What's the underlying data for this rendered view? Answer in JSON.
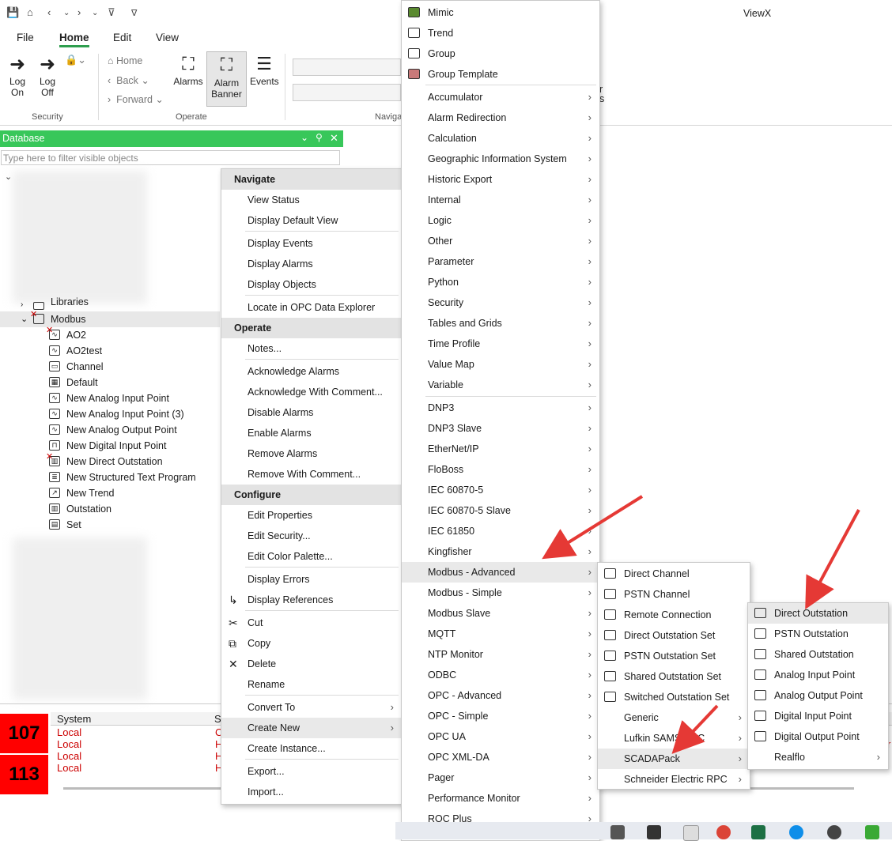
{
  "app": {
    "title": "ViewX"
  },
  "quick_access": {
    "icons": [
      "save-icon",
      "home-icon",
      "back-icon",
      "chevron-down-icon",
      "forward-icon",
      "chevron-down-icon",
      "pointer-icon",
      "customize-icon"
    ]
  },
  "menu_tabs": [
    "File",
    "Home",
    "Edit",
    "View"
  ],
  "ribbon": {
    "log_on": "Log\nOn",
    "log_off": "Log\nOff",
    "home": "Home",
    "back": "Back",
    "forward": "Forward",
    "alarms": "Alarms",
    "alarm_banner": "Alarm\nBanner",
    "events": "Events",
    "groups": {
      "security": "Security",
      "operate": "Operate",
      "navigate": "Naviga"
    },
    "right_partial": [
      "r",
      "s"
    ]
  },
  "database": {
    "title": "Database",
    "filter_placeholder": "Type here to filter visible objects",
    "tree": [
      {
        "label": "Libraries",
        "icon": "folder-icon"
      },
      {
        "label": "Modbus",
        "icon": "folder-icon"
      },
      {
        "label": "AO2",
        "icon": "analog-output-icon"
      },
      {
        "label": "AO2test",
        "icon": "analog-output-icon"
      },
      {
        "label": "Channel",
        "icon": "channel-icon"
      },
      {
        "label": "Default",
        "icon": "mimic-icon"
      },
      {
        "label": "New Analog Input Point",
        "icon": "analog-input-icon"
      },
      {
        "label": "New Analog Input Point (3)",
        "icon": "analog-input-icon"
      },
      {
        "label": "New Analog Output Point",
        "icon": "analog-output-icon"
      },
      {
        "label": "New Digital Input Point",
        "icon": "digital-input-icon"
      },
      {
        "label": "New Direct Outstation",
        "icon": "outstation-icon"
      },
      {
        "label": "New Structured Text Program",
        "icon": "program-icon"
      },
      {
        "label": "New Trend",
        "icon": "trend-icon"
      },
      {
        "label": "Outstation",
        "icon": "outstation-icon"
      },
      {
        "label": "Set",
        "icon": "set-icon"
      }
    ]
  },
  "alarm_banner": {
    "counts": [
      "107",
      "113"
    ],
    "column": "System",
    "column2": "S",
    "rows": [
      "Local",
      "Local",
      "Local",
      "Local"
    ],
    "row_codes": [
      "C",
      "H",
      "H",
      "H"
    ],
    "edge_code": "r"
  },
  "context_menu": {
    "sections": [
      {
        "header": "Navigate",
        "items": [
          "View Status",
          "Display Default View",
          "Display Events",
          "Display Alarms",
          "Display Objects",
          "Locate in OPC Data Explorer"
        ]
      },
      {
        "header": "Operate",
        "items": [
          "Notes...",
          "Acknowledge Alarms",
          "Acknowledge With Comment...",
          "Disable Alarms",
          "Enable Alarms",
          "Remove Alarms",
          "Remove With Comment..."
        ]
      },
      {
        "header": "Configure",
        "items": [
          "Edit Properties",
          "Edit Security...",
          "Edit Color Palette...",
          "Display Errors",
          "Display References",
          "Cut",
          "Copy",
          "Delete",
          "Rename",
          "Convert To",
          "Create New",
          "Create Instance...",
          "Export...",
          "Import..."
        ]
      }
    ]
  },
  "create_new_menu": {
    "top": [
      "Mimic",
      "Trend",
      "Group",
      "Group Template"
    ],
    "items": [
      "Accumulator",
      "Alarm Redirection",
      "Calculation",
      "Geographic Information System",
      "Historic Export",
      "Internal",
      "Logic",
      "Other",
      "Parameter",
      "Python",
      "Security",
      "Tables and Grids",
      "Time Profile",
      "Value Map",
      "Variable",
      "DNP3",
      "DNP3 Slave",
      "EtherNet/IP",
      "FloBoss",
      "IEC 60870-5",
      "IEC 60870-5 Slave",
      "IEC 61850",
      "Kingfisher",
      "Modbus - Advanced",
      "Modbus - Simple",
      "Modbus Slave",
      "MQTT",
      "NTP Monitor",
      "ODBC",
      "OPC - Advanced",
      "OPC - Simple",
      "OPC UA",
      "OPC XML-DA",
      "Pager",
      "Performance Monitor",
      "ROC Plus"
    ]
  },
  "modbus_advanced_menu": {
    "items": [
      "Direct Channel",
      "PSTN Channel",
      "Remote Connection",
      "Direct Outstation Set",
      "PSTN Outstation Set",
      "Shared Outstation Set",
      "Switched Outstation Set",
      "Generic",
      "Lufkin SAMS RPC",
      "SCADAPack",
      "Schneider Electric RPC"
    ]
  },
  "scadapack_menu": {
    "items": [
      "Direct Outstation",
      "PSTN Outstation",
      "Shared Outstation",
      "Analog Input Point",
      "Analog Output Point",
      "Digital Input Point",
      "Digital Output Point",
      "Realflo"
    ]
  },
  "colors": {
    "accent": "#38c75a",
    "alarm": "#ff0000",
    "arrow": "#e53935"
  }
}
